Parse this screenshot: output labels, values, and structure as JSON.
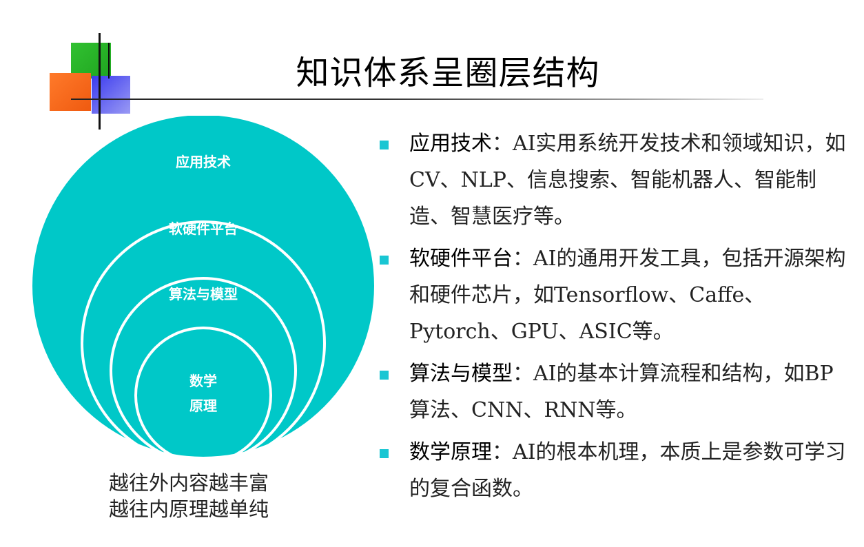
{
  "title": "知识体系呈圈层结构",
  "colors": {
    "circle_fill": "#00C8C8",
    "ring_stroke": "#FFFFFF",
    "bullet_marker": "#19C6D3",
    "logo_green": "#2DB82D",
    "logo_orange": "#F5651A",
    "logo_blue": "#5555EE"
  },
  "diagram": {
    "layers": [
      {
        "label": "应用技术"
      },
      {
        "label": "软硬件平台"
      },
      {
        "label": "算法与模型"
      },
      {
        "label_lines": [
          "数学",
          "原理"
        ]
      }
    ],
    "caption_lines": [
      "越往外内容越丰富",
      "越往内原理越单纯"
    ]
  },
  "bullets": [
    {
      "term": "应用技术",
      "text": "：AI实用系统开发技术和领域知识，如CV、NLP、信息搜索、智能机器人、智能制造、智慧医疗等。"
    },
    {
      "term": "软硬件平台",
      "text": "：AI的通用开发工具，包括开源架构和硬件芯片，如Tensorflow、Caffe、Pytorch、GPU、ASIC等。"
    },
    {
      "term": "算法与模型",
      "text": "：AI的基本计算流程和结构，如BP算法、CNN、RNN等。"
    },
    {
      "term": "数学原理",
      "text": "：AI的根本机理，本质上是参数可学习的复合函数。"
    }
  ]
}
